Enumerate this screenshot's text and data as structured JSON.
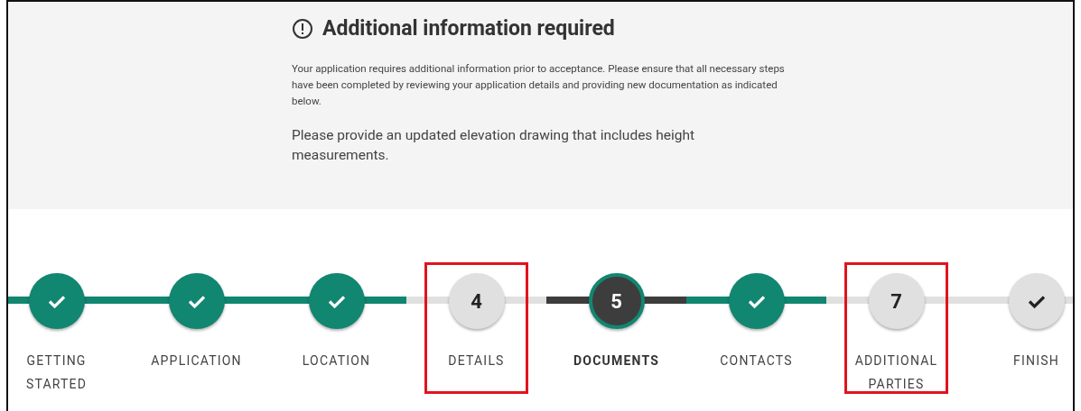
{
  "notice": {
    "title": "Additional information required",
    "message": "Your application requires additional information prior to acceptance. Please ensure that all necessary steps have been completed by reviewing your application details and providing new documentation as indicated below.",
    "instruction": "Please provide an updated elevation drawing that includes height measurements."
  },
  "steps": [
    {
      "label": "GETTING STARTED",
      "kind": "complete",
      "highlighted": false
    },
    {
      "label": "APPLICATION",
      "kind": "complete",
      "highlighted": false
    },
    {
      "label": "LOCATION",
      "kind": "complete",
      "highlighted": false
    },
    {
      "label": "DETAILS",
      "number": "4",
      "kind": "upcoming",
      "highlighted": true
    },
    {
      "label": "DOCUMENTS",
      "number": "5",
      "kind": "current",
      "highlighted": false
    },
    {
      "label": "CONTACTS",
      "kind": "complete",
      "highlighted": false
    },
    {
      "label": "ADDITIONAL PARTIES",
      "number": "7",
      "kind": "upcoming",
      "highlighted": true
    },
    {
      "label": "FINISH",
      "kind": "upcoming",
      "highlighted": false
    }
  ]
}
